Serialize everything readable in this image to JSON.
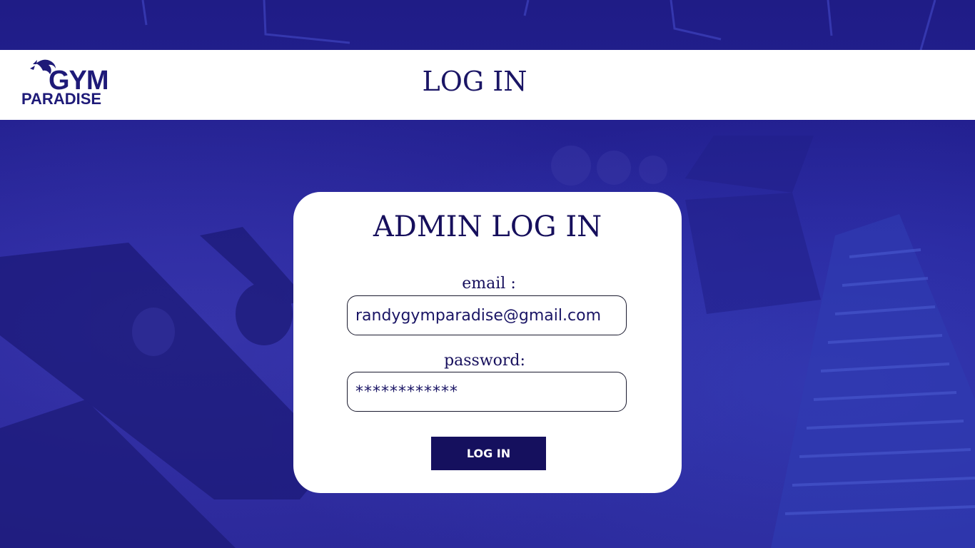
{
  "brand": {
    "logo_line1": "GYM",
    "logo_line2": "PARADISE",
    "logo_icon": "dragon-icon"
  },
  "header": {
    "title": "LOG IN"
  },
  "login_card": {
    "title": "ADMIN LOG IN",
    "email_label": "email :",
    "email_value": "randygymparadise@gmail.com",
    "password_label": "password:",
    "password_value": "************",
    "submit_label": "LOG IN"
  },
  "colors": {
    "brand_navy": "#15105e",
    "background_blue": "#24218f",
    "card_background": "#ffffff"
  }
}
